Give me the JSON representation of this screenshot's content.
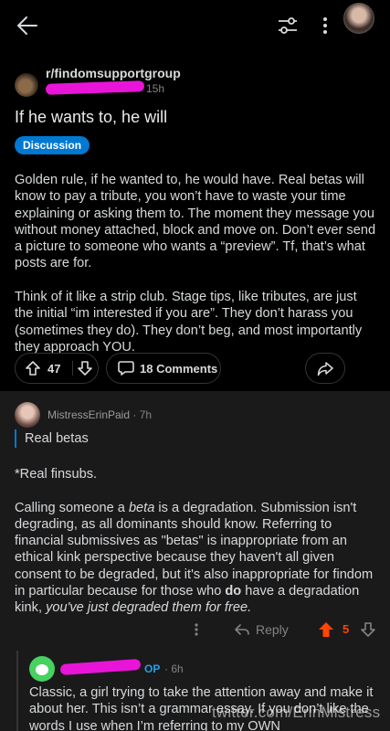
{
  "topbar": {
    "back_icon": "arrow-left-icon",
    "filter_icon": "sort-sliders-icon",
    "more_icon": "more-vertical-icon"
  },
  "post": {
    "subreddit": "r/findomsupportgroup",
    "time": "15h",
    "title": "If he wants to, he will",
    "flair": "Discussion",
    "flair_color": "#0079d3",
    "body": [
      "Golden rule, if he wanted to, he would have. Real betas will know to pay a tribute, you won’t have to waste your time explaining or asking them to. The moment they message you without money attached, block and move on. Don’t ever send a picture to someone who wants a “preview”. Tf, that’s what posts are for.",
      "Think of it like a strip club. Stage tips, like tributes, are just the initial “im interested if you are”. They don’t harass you (sometimes they do). They don’t beg, and most importantly they approach YOU."
    ],
    "votes": "47",
    "comments_label": "18 Comments"
  },
  "comment1": {
    "author": "MistressErinPaid",
    "time": "7h",
    "quote": "Real betas",
    "body": {
      "p1": "*Real finsubs.",
      "p2_a": "Calling someone a ",
      "p2_em": "beta",
      "p2_b": " is a degradation. Submission isn't degrading, as all dominants should know. Referring to financial submissives as \"betas\" is inappropriate from an ethical kink perspective because they haven't all given consent to be degraded, but it's also inappropriate for findom in particular because for those who ",
      "p2_strong": "do",
      "p2_c": " have a degradation kink, ",
      "p2_em2": "you've just degraded them for free."
    },
    "reply_label": "Reply",
    "score": "5",
    "score_color": "#ff4500"
  },
  "comment2": {
    "op_badge": "OP",
    "time": "6h",
    "body": "Classic, a girl trying to take the attention away and make it about her. This isn’t a grammar essay. If you don’t like the words I use when I’m referring to my OWN"
  },
  "watermark": "twitter.com/ErinMistress"
}
